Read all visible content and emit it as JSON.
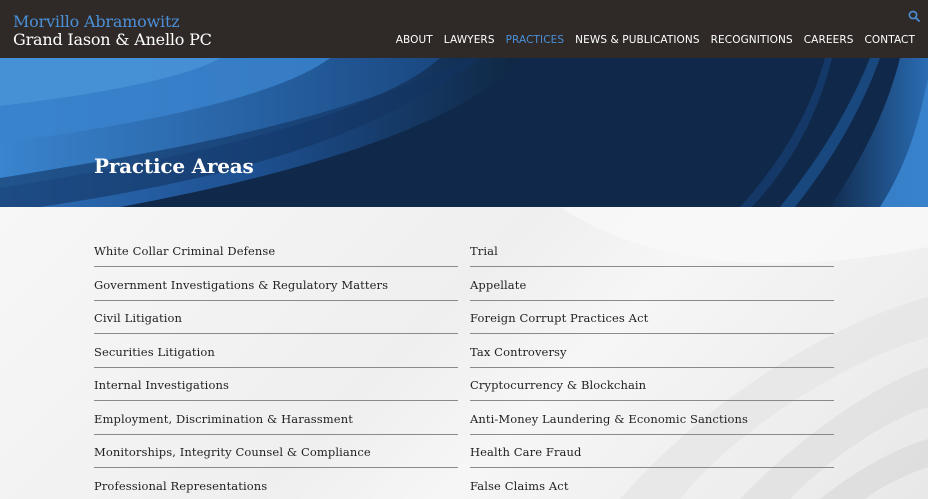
{
  "logo": {
    "line1": "Morvillo Abramowitz",
    "line2": "Grand Iason & Anello PC"
  },
  "icons": {
    "search": "search-icon"
  },
  "nav": [
    {
      "label": "ABOUT"
    },
    {
      "label": "LAWYERS"
    },
    {
      "label": "PRACTICES",
      "active": true
    },
    {
      "label": "NEWS & PUBLICATIONS"
    },
    {
      "label": "RECOGNITIONS"
    },
    {
      "label": "CAREERS"
    },
    {
      "label": "CONTACT"
    }
  ],
  "hero": {
    "title": "Practice Areas"
  },
  "practices": {
    "left": [
      "White Collar Criminal Defense",
      "Government Investigations & Regulatory Matters",
      "Civil Litigation",
      "Securities Litigation",
      "Internal Investigations",
      "Employment, Discrimination & Harassment",
      "Monitorships, Integrity Counsel & Compliance",
      "Professional Representations"
    ],
    "right": [
      "Trial",
      "Appellate",
      "Foreign Corrupt Practices Act",
      "Tax Controversy",
      "Cryptocurrency & Blockchain",
      "Anti-Money Laundering & Economic Sanctions",
      "Health Care Fraud",
      "False Claims Act"
    ]
  },
  "colors": {
    "header_bg": "#2f2a28",
    "accent": "#4a90d9",
    "hero_bg": "#0f2743"
  }
}
